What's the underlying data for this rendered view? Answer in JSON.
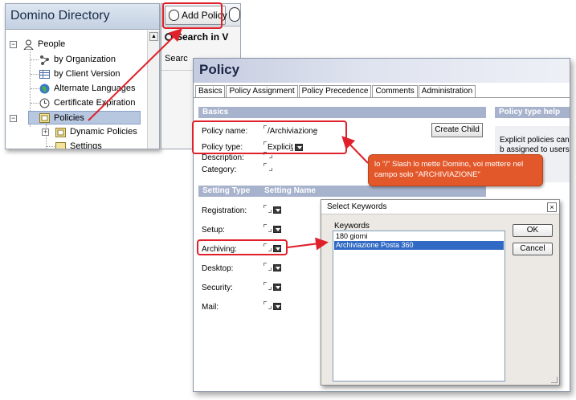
{
  "navigator": {
    "title": "Domino Directory",
    "items": [
      {
        "label": "People"
      },
      {
        "label": "by Organization"
      },
      {
        "label": "by Client Version"
      },
      {
        "label": "Alternate Languages"
      },
      {
        "label": "Certificate Expiration"
      },
      {
        "label": "Policies"
      },
      {
        "label": "Dynamic Policies"
      },
      {
        "label": "Settings"
      }
    ]
  },
  "background_app": {
    "add_policy_label": "Add Policy",
    "search_label": "Search in V",
    "search_field_label": "Searc"
  },
  "policy_form": {
    "title": "Policy",
    "tabs": [
      "Basics",
      "Policy Assignment",
      "Policy Precedence",
      "Comments",
      "Administration"
    ],
    "basics_header": "Basics",
    "help_header": "Policy type help",
    "help_text": "Explicit policies can b assigned to users in th",
    "fields": {
      "policy_name_label": "Policy name:",
      "policy_name_value": "/Archiviazione",
      "policy_type_label": "Policy type:",
      "policy_type_value": "Explicit",
      "description_label": "Description:",
      "category_label": "Category:"
    },
    "create_child_label": "Create Child",
    "settings_header_type": "Setting Type",
    "settings_header_name": "Setting Name",
    "settings": [
      {
        "label": "Registration:"
      },
      {
        "label": "Setup:"
      },
      {
        "label": "Archiving:"
      },
      {
        "label": "Desktop:"
      },
      {
        "label": "Security:"
      },
      {
        "label": "Mail:"
      }
    ]
  },
  "dialog": {
    "title": "Select Keywords",
    "close_glyph": "×",
    "keywords_label": "Keywords",
    "keywords": [
      "180 giorni",
      "Archiviazione Posta 360"
    ],
    "selected_index": 1,
    "ok_label": "OK",
    "cancel_label": "Cancel"
  },
  "annotation": {
    "text": "lo \"/\" Slash lo mette Domino, voi mettere nel campo solo \"ARCHIVIAZIONE\""
  },
  "colors": {
    "highlight_red": "#e0202a",
    "callout_orange": "#e3582a",
    "section_header": "#a7b2cc",
    "selection_blue": "#316ac5"
  }
}
